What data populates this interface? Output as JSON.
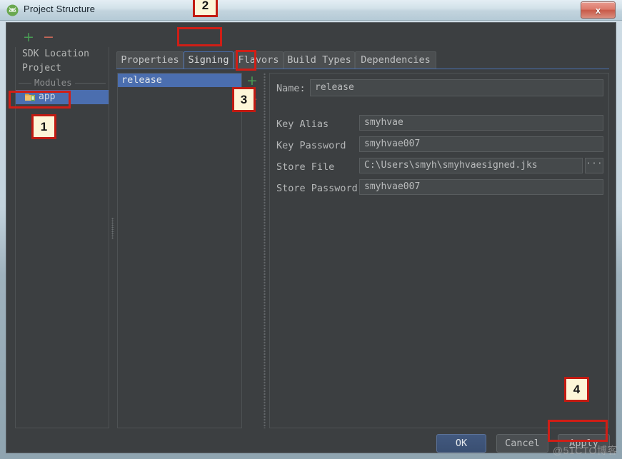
{
  "window": {
    "title": "Project Structure",
    "app_icon": "android-studio-icon",
    "close_label": "x"
  },
  "sidebar": {
    "toolbar": {
      "add": "+",
      "remove": "−"
    },
    "items": [
      {
        "label": "SDK Location",
        "type": "row",
        "selected": false
      },
      {
        "label": "Project",
        "type": "row",
        "selected": false
      },
      {
        "label": "Modules",
        "type": "group",
        "selected": false
      },
      {
        "label": "app",
        "type": "row",
        "selected": true,
        "icon": "module-folder-icon"
      }
    ]
  },
  "tabs": [
    {
      "label": "Properties",
      "active": false
    },
    {
      "label": "Signing",
      "active": true
    },
    {
      "label": "Flavors",
      "active": false
    },
    {
      "label": "Build Types",
      "active": false
    },
    {
      "label": "Dependencies",
      "active": false
    }
  ],
  "config_list": {
    "items": [
      {
        "label": "release",
        "selected": true
      }
    ],
    "add": "+",
    "remove": "−"
  },
  "form": {
    "name": {
      "label": "Name:",
      "value": "release"
    },
    "key_alias": {
      "label": "Key Alias",
      "value": "smyhvae"
    },
    "key_password": {
      "label": "Key Password",
      "value": "smyhvae007"
    },
    "store_file": {
      "label": "Store File",
      "value": "C:\\Users\\smyh\\smyhvaesigned.jks",
      "browse": "···"
    },
    "store_password": {
      "label": "Store Password",
      "value": "smyhvae007"
    }
  },
  "buttons": {
    "ok": "OK",
    "cancel": "Cancel",
    "apply_prefix": "A",
    "apply_rest": "pply"
  },
  "annotations": [
    {
      "number": "1",
      "target": "sidebar-item-app"
    },
    {
      "number": "2",
      "target": "tab-signing"
    },
    {
      "number": "3",
      "target": "config-add-button"
    },
    {
      "number": "4",
      "target": "apply-button"
    }
  ],
  "watermark": "@51CTO博客",
  "colors": {
    "accent_selection": "#4b6eaf",
    "panel_bg": "#3c3f41",
    "annotation_red": "#d01e16",
    "badge_bg": "#fdf6d8",
    "add_green": "#499c54",
    "remove_red": "#cf6a5a"
  }
}
